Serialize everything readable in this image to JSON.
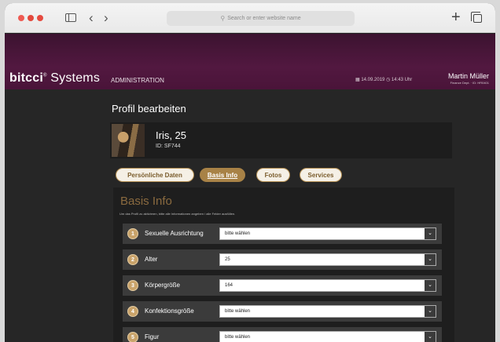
{
  "browser": {
    "url_placeholder": "Search or enter website name"
  },
  "header": {
    "logo_part1": "bitcci",
    "logo_reg": "®",
    "logo_part2": "Systems",
    "admin_label": "ADMINISTRATION",
    "date_text": "▦ 14.09.2019  ◷ 14:43 Uhr",
    "user_name": "Martin Müller",
    "user_dept": "Finance Dept. · ID: HR0401"
  },
  "page": {
    "title": "Profil bearbeiten"
  },
  "profile": {
    "name": "Iris, 25",
    "id": "ID: SF744"
  },
  "tabs": [
    {
      "label": "Persönliche Daten",
      "active": false
    },
    {
      "label": "Basis Info",
      "active": true
    },
    {
      "label": "Fotos",
      "active": false
    },
    {
      "label": "Services",
      "active": false
    }
  ],
  "section": {
    "title": "Basis Info",
    "description": "Um das Profil zu aktivieren, bitte alle Informationen angeben / alle Felder ausfüllen.",
    "fields": [
      {
        "num": "1",
        "label": "Sexuelle Ausrichtung",
        "value": "bitte wählen"
      },
      {
        "num": "2",
        "label": "Alter",
        "value": "25"
      },
      {
        "num": "3",
        "label": "Körpergröße",
        "value": "164"
      },
      {
        "num": "4",
        "label": "Konfektionsgröße",
        "value": "bitte wählen"
      },
      {
        "num": "5",
        "label": "Figur",
        "value": "bitte wählen"
      }
    ]
  }
}
